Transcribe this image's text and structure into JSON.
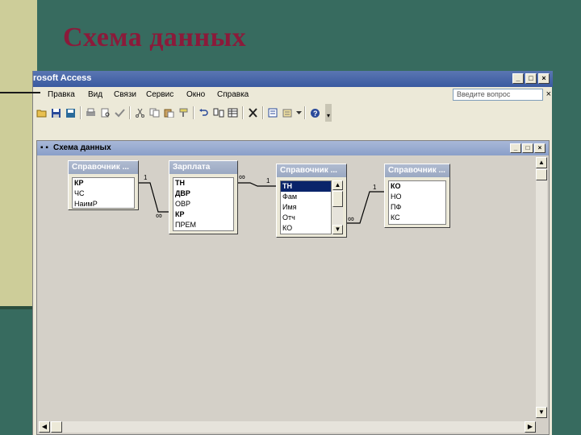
{
  "slide": {
    "title": "Схема данных"
  },
  "app": {
    "title": "rosoft Access",
    "window_buttons": [
      "_",
      "□",
      "×"
    ],
    "menu": [
      "Правка",
      "Вид",
      "Связи",
      "Сервис",
      "Окно",
      "Справка"
    ],
    "ask_placeholder": "Введите вопрос",
    "menu_close": "×"
  },
  "toolbar": {
    "icons": [
      "open-icon",
      "save-icon",
      "save-as-icon",
      "print-icon",
      "print-preview-icon",
      "spell-check-icon",
      "cut-icon",
      "copy-icon",
      "paste-icon",
      "format-painter-icon",
      "undo-icon",
      "show-table-icon",
      "show-all-icon",
      "delete-icon",
      "relationships-icon",
      "new-object-icon",
      "help-icon"
    ]
  },
  "doc": {
    "title": "Схема данных",
    "window_buttons": [
      "_",
      "□",
      "×"
    ]
  },
  "tables": [
    {
      "title": "Справочник ...",
      "fields": [
        "КР",
        "ЧС",
        "НаимР"
      ],
      "bold": [
        0
      ],
      "selected": -1
    },
    {
      "title": "Зарплата",
      "fields": [
        "ТН",
        "ДВР",
        "ОВР",
        "КР",
        "ПРЕМ"
      ],
      "bold": [
        0,
        1,
        3
      ],
      "selected": -1
    },
    {
      "title": "Справочник ...",
      "fields": [
        "ТН",
        "Фам",
        "Имя",
        "Отч",
        "КО"
      ],
      "bold": [],
      "selected": 0
    },
    {
      "title": "Справочник ...",
      "fields": [
        "КО",
        "НО",
        "ПФ",
        "КС"
      ],
      "bold": [
        0
      ],
      "selected": -1
    }
  ],
  "relations": [
    {
      "one": "1",
      "many": "∞"
    },
    {
      "one": "1",
      "many": "∞"
    },
    {
      "one": "1",
      "many": "∞"
    }
  ]
}
